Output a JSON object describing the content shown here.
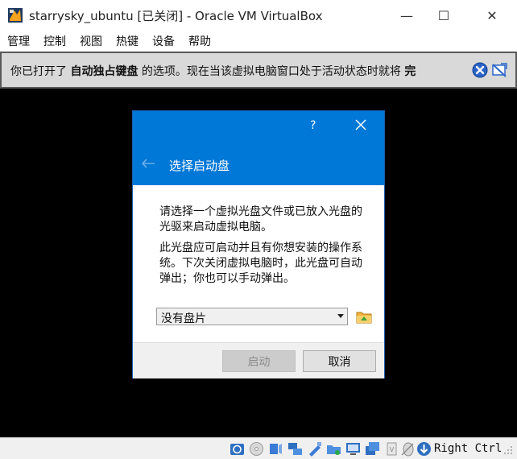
{
  "window": {
    "title": "starrysky_ubuntu [已关闭] - Oracle VM VirtualBox",
    "icon": "virtualbox-app-icon",
    "min_glyph": "—",
    "max_glyph": "☐",
    "close_glyph": "✕"
  },
  "menubar": {
    "items": [
      "管理",
      "控制",
      "视图",
      "热键",
      "设备",
      "帮助"
    ]
  },
  "notification": {
    "prefix": "你已打开了",
    "bold_term": "自动独占键盘",
    "suffix": "的选项。现在当该虚拟电脑窗口处于活动状态时就将",
    "trailing_bold": "完",
    "close_icon": "close-icon",
    "hide_icon": "hide-message-icon"
  },
  "dialog": {
    "help_label": "?",
    "title": "选择启动盘",
    "para1": "请选择一个虚拟光盘文件或已放入光盘的光驱来启动虚拟电脑。",
    "para2": "此光盘应可启动并且有你想安装的操作系统。下次关闭虚拟电脑时，此光盘可自动弹出；你也可以手动弹出。",
    "combo_value": "没有盘片",
    "start_button": "启动",
    "cancel_button": "取消",
    "header_color": "#0078d7"
  },
  "statusbar": {
    "icons": [
      "hard-disk-icon",
      "optical-drive-icon",
      "audio-icon",
      "network-icon",
      "usb-icon",
      "shared-folders-icon",
      "display-icon",
      "video-capture-icon",
      "cpu-icon",
      "mouse-integration-icon",
      "keyboard-capture-icon"
    ],
    "host_key": "Right Ctrl"
  }
}
